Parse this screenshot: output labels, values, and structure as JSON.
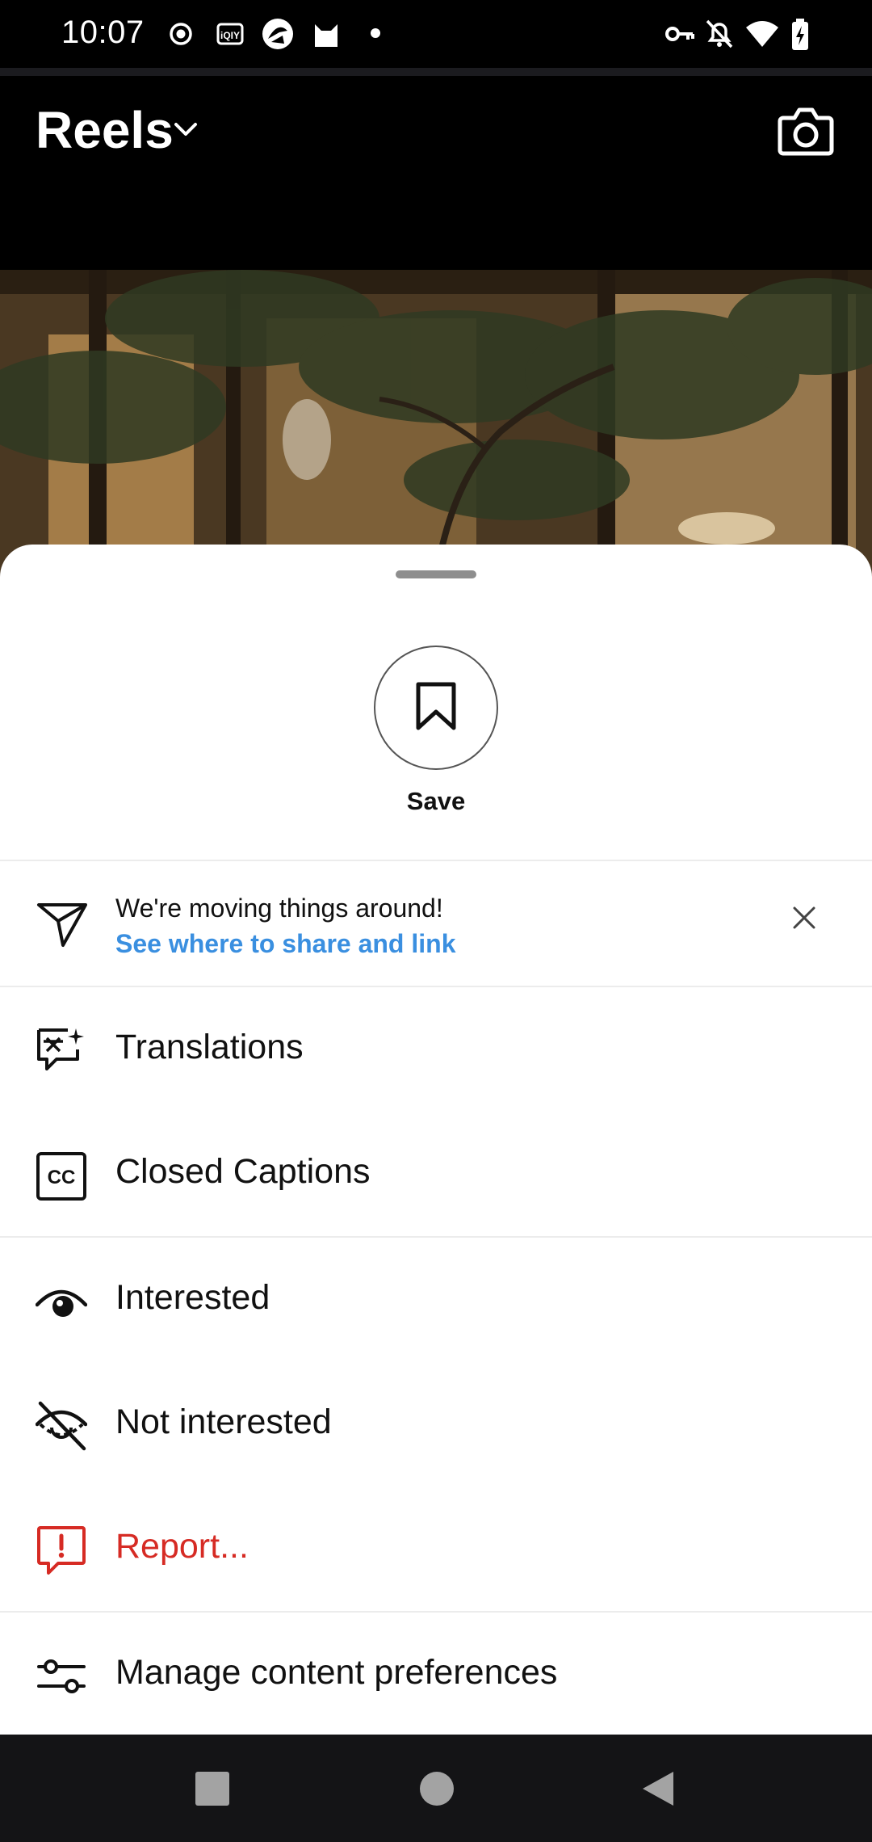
{
  "status_bar": {
    "time": "10:07",
    "left_icons": [
      "record-icon",
      "iqiyi-icon",
      "app-icon",
      "cat-icon",
      "dot-icon"
    ],
    "right_icons": [
      "vpn-key-icon",
      "notifications-off-icon",
      "wifi-icon",
      "battery-charging-icon"
    ]
  },
  "header": {
    "title": "Reels",
    "dropdown_icon": "chevron-down-icon",
    "camera_icon": "camera-icon"
  },
  "sheet": {
    "save": {
      "label": "Save",
      "icon": "bookmark-icon"
    },
    "banner": {
      "icon": "send-icon",
      "title": "We're moving things around!",
      "link": "See where to share and link",
      "close_icon": "close-icon"
    },
    "menu": [
      {
        "label": "Translations",
        "icon": "translate-icon"
      },
      {
        "label": "Closed Captions",
        "icon": "closed-captions-icon"
      },
      {
        "label": "Interested",
        "icon": "eye-icon"
      },
      {
        "label": "Not interested",
        "icon": "eye-off-icon"
      },
      {
        "label": "Report...",
        "icon": "report-icon",
        "color": "#d62b24"
      },
      {
        "label": "Manage content preferences",
        "icon": "sliders-icon"
      }
    ]
  },
  "nav_bar": {
    "recents_icon": "square-icon",
    "home_icon": "circle-icon",
    "back_icon": "triangle-back-icon"
  },
  "colors": {
    "link": "#3a8fe0",
    "danger": "#d62b24"
  }
}
